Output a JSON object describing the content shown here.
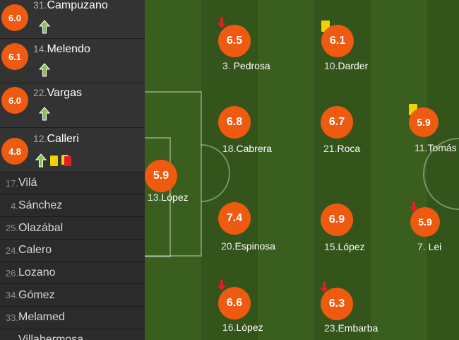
{
  "subs": [
    {
      "rating": "6.0",
      "number": "31.",
      "name": "Campuzano",
      "cards": []
    },
    {
      "rating": "6.1",
      "number": "14.",
      "name": "Melendo",
      "cards": []
    },
    {
      "rating": "6.0",
      "number": "22.",
      "name": "Vargas",
      "cards": []
    },
    {
      "rating": "4.8",
      "number": "12.",
      "name": "Calleri",
      "cards": [
        "yellow",
        "yellow-red"
      ]
    }
  ],
  "bench": [
    {
      "number": "17.",
      "name": "Vilá"
    },
    {
      "number": "4.",
      "name": "Sánchez"
    },
    {
      "number": "25.",
      "name": "Olazábal"
    },
    {
      "number": "24.",
      "name": "Calero"
    },
    {
      "number": "26.",
      "name": "Lozano"
    },
    {
      "number": "34.",
      "name": "Gómez"
    },
    {
      "number": "33.",
      "name": "Melamed"
    },
    {
      "number": "",
      "name": "Villahermosa"
    }
  ],
  "players": [
    {
      "id": "lopez-gk",
      "rating": "5.9",
      "number": "13.",
      "name": "López",
      "subbed_off": false,
      "yellow_card": false
    },
    {
      "id": "pedrosa",
      "rating": "6.5",
      "number": "3.",
      "name": "Pedrosa",
      "subbed_off": true,
      "yellow_card": false
    },
    {
      "id": "cabrera",
      "rating": "6.8",
      "number": "18.",
      "name": "Cabrera",
      "subbed_off": false,
      "yellow_card": false
    },
    {
      "id": "espinosa",
      "rating": "7.4",
      "number": "20.",
      "name": "Espinosa",
      "subbed_off": false,
      "yellow_card": false
    },
    {
      "id": "lopez-16",
      "rating": "6.6",
      "number": "16.",
      "name": "López",
      "subbed_off": true,
      "yellow_card": false
    },
    {
      "id": "darder",
      "rating": "6.1",
      "number": "10.",
      "name": "Darder",
      "subbed_off": false,
      "yellow_card": true
    },
    {
      "id": "roca",
      "rating": "6.7",
      "number": "21.",
      "name": "Roca",
      "subbed_off": false,
      "yellow_card": false
    },
    {
      "id": "lopez-15",
      "rating": "6.9",
      "number": "15.",
      "name": "López",
      "subbed_off": false,
      "yellow_card": false
    },
    {
      "id": "embarba",
      "rating": "6.3",
      "number": "23.",
      "name": "Embarba",
      "subbed_off": true,
      "yellow_card": false
    },
    {
      "id": "tomas",
      "rating": "5.9",
      "number": "11.",
      "name": "Tomás",
      "subbed_off": false,
      "yellow_card": true
    },
    {
      "id": "lei",
      "rating": "5.9",
      "number": "7.",
      "name": "Lei",
      "subbed_off": true,
      "yellow_card": false
    }
  ],
  "colors": {
    "rating": "#ee5a10",
    "sub_on": "#8bc34a",
    "sub_off": "#e01f26",
    "yellow_card": "#f0d400"
  }
}
